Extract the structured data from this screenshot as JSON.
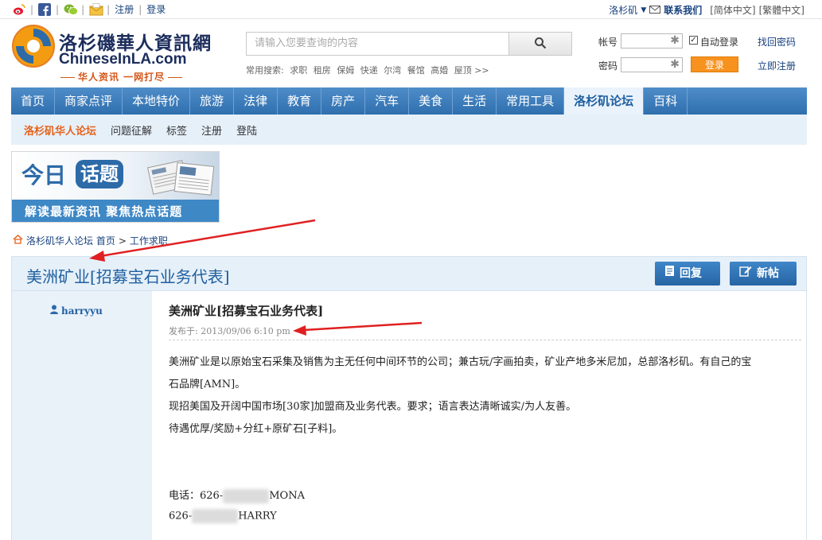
{
  "topbar": {
    "register": "注册",
    "login": "登录",
    "city": "洛杉矶",
    "contact": "联系我们",
    "lang_simplified": "[简体中文]",
    "lang_traditional": "[繁體中文]"
  },
  "logo": {
    "name_cn": "洛杉磯華人資訊網",
    "name_en": "ChineseInLA.com",
    "slogan": "华人资讯 一网打尽"
  },
  "search": {
    "placeholder": "请输入您要查询的内容",
    "hot_label": "常用搜索:",
    "hot_terms": [
      "求职",
      "租房",
      "保姆",
      "快递",
      "尔湾",
      "餐馆",
      "高婚",
      "屋顶 >>"
    ]
  },
  "login": {
    "account_label": "帐号",
    "password_label": "密码",
    "auto_login": "自动登录",
    "submit": "登录",
    "find_password": "找回密码",
    "register_now": "立即注册"
  },
  "nav": {
    "items": [
      "首页",
      "商家点评",
      "本地特价",
      "旅游",
      "法律",
      "教育",
      "房产",
      "汽车",
      "美食",
      "生活",
      "常用工具",
      "洛杉矶论坛",
      "百科"
    ],
    "active_index": 11
  },
  "subnav": {
    "items": [
      "洛杉矶华人论坛",
      "问题征解",
      "标签",
      "注册",
      "登陆"
    ]
  },
  "banner": {
    "today": "今日",
    "topic": "话题",
    "tagline": "解读最新资讯  聚焦热点话题"
  },
  "breadcrumb": {
    "home": "洛杉矶华人论坛 首页",
    "separator": ">",
    "section": "工作求职"
  },
  "thread": {
    "title": "美洲矿业[招募宝石业务代表]",
    "reply_button": "回复",
    "new_post_button": "新帖"
  },
  "post": {
    "author": "harryyu",
    "title": "美洲矿业[招募宝石业务代表]",
    "date": "发布于: 2013/09/06  6:10 pm",
    "body": [
      "美洲矿业是以原始宝石采集及销售为主无任何中间环节的公司；兼古玩/字画拍卖，矿业产地多米尼加，总部洛杉矶。有自己的宝",
      "石品牌[AMN]。",
      "现招美国及开阔中国市场[30家]加盟商及业务代表。要求；语言表达清晰诚实/为人友善。",
      "待遇优厚/奖励+分红+原矿石[子料]。"
    ],
    "phone1_label": "电话：626-",
    "phone1_name": "MONA",
    "phone2_label": "626-",
    "phone2_name": "HARRY"
  },
  "colors": {
    "nav_blue": "#2f6fae",
    "brand_orange": "#e5621a",
    "link_blue": "#16407e",
    "annotation_red": "#e02020"
  }
}
